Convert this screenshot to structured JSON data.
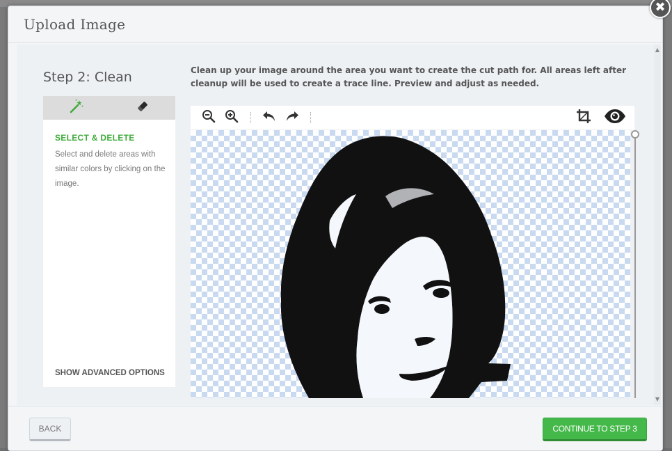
{
  "modal": {
    "title": "Upload Image",
    "close_icon": "close-icon"
  },
  "step": {
    "title": "Step 2: Clean",
    "instruction": "Clean up your image around the area you want to create the cut path for. All areas left after cleanup will be used to create a trace line. Preview and adjust as needed."
  },
  "tool_panel": {
    "tabs": [
      {
        "icon": "magic-wand-icon",
        "active": true
      },
      {
        "icon": "eraser-icon",
        "active": false
      }
    ],
    "heading": "SELECT & DELETE",
    "description": "Select and delete areas with similar colors by clicking on the image.",
    "advanced_link": "SHOW ADVANCED OPTIONS"
  },
  "toolbar": {
    "buttons": [
      "zoom-out-icon",
      "zoom-in-icon",
      "undo-icon",
      "redo-icon",
      "crop-icon",
      "preview-eye-icon"
    ]
  },
  "colors": {
    "accent_green": "#45b84a",
    "heading_green": "#3fab3a",
    "checker_blue": "#c9daf0"
  },
  "footer": {
    "back_label": "BACK",
    "continue_label": "CONTINUE TO STEP 3"
  }
}
